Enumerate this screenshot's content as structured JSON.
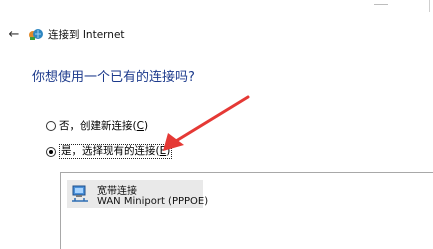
{
  "window": {
    "title": "连接到 Internet"
  },
  "question": "你想使用一个已有的连接吗?",
  "options": [
    {
      "label_prefix": "否，创建新连接(",
      "access_key": "C",
      "label_suffix": ")",
      "selected": false
    },
    {
      "label_prefix": "是，选择现有的连接(",
      "access_key": "E",
      "label_suffix": ")",
      "selected": true
    }
  ],
  "connections": [
    {
      "name": "宽带连接",
      "device": "WAN Miniport (PPPOE)",
      "icon": "network-connection-icon"
    }
  ],
  "icons": {
    "back": "back-arrow-icon",
    "wizard": "network-wizard-icon"
  },
  "colors": {
    "question": "#1c3a8c",
    "annotation_arrow": "#e53935"
  }
}
